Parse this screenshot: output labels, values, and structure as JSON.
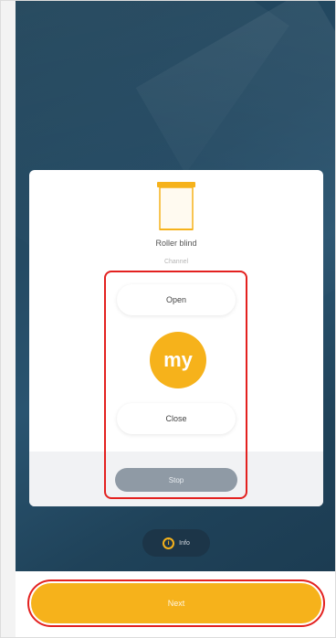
{
  "device": {
    "name": "Roller blind",
    "subtitle": "Channel",
    "icon": "roller-blind-icon"
  },
  "controls": {
    "open_label": "Open",
    "my_label": "my",
    "close_label": "Close",
    "stop_label": "Stop"
  },
  "info": {
    "label": "Info",
    "icon": "info-icon"
  },
  "footer": {
    "next_label": "Next"
  },
  "colors": {
    "accent": "#f6b21b",
    "background": "#244a63",
    "stop": "#8f9aa5",
    "highlight": "#e3211f"
  }
}
